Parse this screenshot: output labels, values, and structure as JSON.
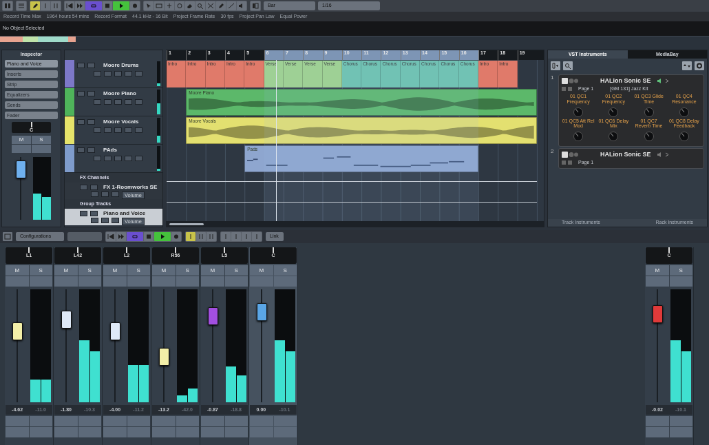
{
  "toolbar": {
    "transport": {
      "cycle": true,
      "playing": true
    },
    "snap_type": "Bar",
    "quantize": "1/16"
  },
  "info_bar": [
    {
      "label": "Record Time Max",
      "value": "1964 hours 54 mins"
    },
    {
      "label": "Record Format",
      "value": "44.1 kHz - 16 Bit"
    },
    {
      "label": "Project Frame Rate",
      "value": "30 fps"
    },
    {
      "label": "Project Pan Law",
      "value": "Equal Power"
    }
  ],
  "info_line": "No Object Selected",
  "inspector": {
    "title": "Inspector",
    "track_preset": "Piano and Voice",
    "sections": [
      "Inserts",
      "Strip",
      "Equalizers",
      "Sends",
      "Fader"
    ],
    "fader": {
      "pan": "C",
      "buttons": [
        "M",
        "S"
      ],
      "level": 0.8,
      "meters": [
        {
          "level": 0.42
        },
        {
          "level": 0.36
        }
      ]
    }
  },
  "tracks": [
    {
      "name": "Moore Drums",
      "color": "#7d78c8",
      "selected": false,
      "level": 0.12
    },
    {
      "name": "Moore Piano",
      "color": "#4fb35a",
      "selected": false,
      "level": 0.45
    },
    {
      "name": "Moore Vocals",
      "color": "#e6e36a",
      "selected": false,
      "level": 0.28
    },
    {
      "name": "PAds",
      "color": "#7f9ccc",
      "selected": false,
      "level": 0.08
    }
  ],
  "folders": [
    {
      "name": "FX Channels",
      "children": [
        {
          "name": "FX 1-Roomworks SE",
          "automation": "Volume",
          "selected": false
        }
      ]
    },
    {
      "name": "Group Tracks",
      "children": [
        {
          "name": "Piano and Voice",
          "automation": "Volume",
          "selected": true
        }
      ]
    }
  ],
  "arrangement": {
    "ruler": [
      "1",
      "2",
      "3",
      "4",
      "5",
      "6",
      "7",
      "8",
      "9",
      "10",
      "11",
      "12",
      "13",
      "14",
      "15",
      "16",
      "17",
      "18",
      "19"
    ],
    "drum_parts": [
      {
        "label": "Intro",
        "kind": "intro"
      },
      {
        "label": "Intro",
        "kind": "intro"
      },
      {
        "label": "Intro",
        "kind": "intro"
      },
      {
        "label": "Intro",
        "kind": "intro"
      },
      {
        "label": "Intro",
        "kind": "intro"
      },
      {
        "label": "Verse",
        "kind": "verse"
      },
      {
        "label": "Verse",
        "kind": "verse"
      },
      {
        "label": "Verse",
        "kind": "verse"
      },
      {
        "label": "Verse",
        "kind": "verse"
      },
      {
        "label": "Chorus",
        "kind": "chorus"
      },
      {
        "label": "Chorus",
        "kind": "chorus"
      },
      {
        "label": "Chorus",
        "kind": "chorus"
      },
      {
        "label": "Chorus",
        "kind": "chorus"
      },
      {
        "label": "Chorus",
        "kind": "chorus"
      },
      {
        "label": "Chorus",
        "kind": "chorus"
      },
      {
        "label": "Chorus",
        "kind": "chorus"
      },
      {
        "label": "Intro",
        "kind": "intro"
      },
      {
        "label": "Intro",
        "kind": "intro"
      }
    ],
    "events": [
      {
        "name": "Moore Piano",
        "kind": "audio",
        "color": "#5cb86a"
      },
      {
        "name": "Moore Vocals",
        "kind": "audio",
        "color": "#e3e070"
      },
      {
        "name": "Pads",
        "kind": "midi",
        "color": "#8ea6cf"
      }
    ]
  },
  "vst_panel": {
    "tabs": [
      {
        "label": "VST Instruments",
        "selected": true
      },
      {
        "label": "MediaBay",
        "selected": false
      }
    ],
    "slots": [
      {
        "number": "1",
        "name": "HALion Sonic SE",
        "page": "Page 1",
        "program": "[GM 131] Jazz Kit",
        "expanded": true,
        "quick_controls": [
          "01 QC1 Frequency",
          "01 QC2 Frequency",
          "01 QC3 Glide Time",
          "01 QC4 Resonance",
          "01 QC5 Att Rel Mod",
          "01 QC6 Delay Mix",
          "01 QC7 Reverb Time",
          "01 QC8 Delay Feedback"
        ]
      },
      {
        "number": "2",
        "name": "HALion Sonic SE",
        "page": "Page 1",
        "expanded": false
      }
    ],
    "footer": [
      "Track Instruments",
      "Rack Instruments"
    ]
  },
  "mixer_toolbar": {
    "configurations": "Configurations",
    "transport": {
      "cycle": true,
      "playing": true
    },
    "link": "Link"
  },
  "mixer": {
    "channels": [
      {
        "name": "L1",
        "buttons": [
          "M",
          "S"
        ],
        "color": "#f3efa8",
        "level": 0.63,
        "meters": [
          {
            "level": 0.2
          },
          {
            "level": 0.2
          }
        ],
        "volume": "-4.62",
        "peak": "-11.0",
        "selected": false
      },
      {
        "name": "L42",
        "buttons": [
          "M",
          "S"
        ],
        "color": "#dfe9f7",
        "level": 0.73,
        "meters": [
          {
            "level": 0.55
          },
          {
            "level": 0.45
          }
        ],
        "volume": "-1.80",
        "peak": "-10.3",
        "selected": false
      },
      {
        "name": "L2",
        "buttons": [
          "M",
          "S"
        ],
        "color": "#dfe9f7",
        "level": 0.63,
        "meters": [
          {
            "level": 0.33
          },
          {
            "level": 0.33
          }
        ],
        "volume": "-4.00",
        "peak": "-11.2",
        "selected": false
      },
      {
        "name": "R56",
        "buttons": [
          "M",
          "S"
        ],
        "color": "#f3efa8",
        "level": 0.4,
        "meters": [
          {
            "level": 0.06
          },
          {
            "level": 0.12
          }
        ],
        "volume": "-13.2",
        "peak": "-42.0",
        "selected": false
      },
      {
        "name": "L5",
        "buttons": [
          "M",
          "S"
        ],
        "color": "#a24fe0",
        "level": 0.76,
        "meters": [
          {
            "level": 0.32
          },
          {
            "level": 0.24
          }
        ],
        "volume": "-0.87",
        "peak": "-18.8",
        "selected": false
      },
      {
        "name": "C",
        "buttons": [
          "M",
          "S"
        ],
        "color": "#5aa6e6",
        "level": 0.8,
        "meters": [
          {
            "level": 0.55
          },
          {
            "level": 0.45
          }
        ],
        "volume": "0.00",
        "peak": "-10.1",
        "selected": true
      }
    ],
    "master": {
      "name": "C",
      "buttons": [
        "M",
        "S"
      ],
      "color": "#e03a3a",
      "level": 0.78,
      "meters": [
        {
          "level": 0.55
        },
        {
          "level": 0.45
        }
      ],
      "volume": "-0.02",
      "peak": "-10.1",
      "selected": false
    }
  }
}
